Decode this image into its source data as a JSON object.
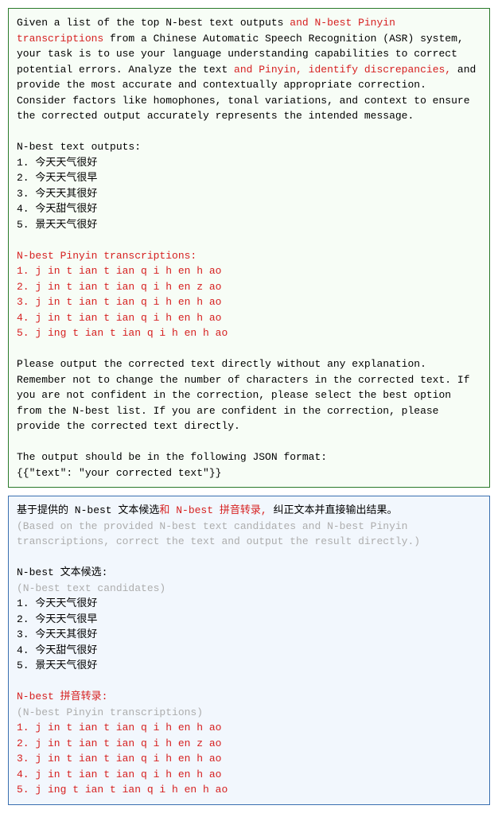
{
  "box1": {
    "intro": {
      "p1a": "Given a list of the top N-best text outputs ",
      "p1b": "and N-best Pinyin transcriptions",
      "p2": " from a Chinese Automatic Speech Recognition (ASR) system, your task is to use your language understanding capabilities to correct potential errors. Analyze the text ",
      "p2b": "and Pinyin, identify discrepancies,",
      "p2c": " and provide the most accurate and contextually appropriate correction. Consider factors like homophones, tonal variations, and context to ensure the corrected output accurately represents the intended message."
    },
    "sec1_title": "N-best text outputs:",
    "sec1_items": [
      "1. 今天天气很好",
      "2. 今天天气很早",
      "3. 今天天其很好",
      "4. 今天甜气很好",
      "5. 景天天气很好"
    ],
    "sec2_title": "N-best Pinyin transcriptions:",
    "sec2_items": [
      "1. j in t ian t ian q i h en h ao",
      "2. j in t ian t ian q i h en z ao",
      "3. j in t ian t ian q i h en h ao",
      "4. j in t ian t ian q i h en h ao",
      "5. j ing t ian t ian q i h en h ao"
    ],
    "outro1": "Please output the corrected text directly without any explanation. Remember not to change the number of characters in the corrected text. If you are not confident in the correction, please select the best option from the N-best list. If you are confident in the correction, please provide the corrected text directly.",
    "outro2": "The output should be in the following JSON format:",
    "outro3": "{{\"text\": \"your corrected text\"}}"
  },
  "box2": {
    "intro": {
      "a": "基于提供的 N-best 文本候选",
      "b": "和 N-best 拼音转录, ",
      "c": "纠正文本并直接输出结果。"
    },
    "intro_gray": "(Based on the provided N-best text candidates and N-best Pinyin transcriptions, correct the text and output the result directly.)",
    "sec1_title": "N-best 文本候选:",
    "sec1_gray": "(N-best text candidates)",
    "sec1_items": [
      "1. 今天天气很好",
      "2. 今天天气很早",
      "3. 今天天其很好",
      "4. 今天甜气很好",
      "5. 景天天气很好"
    ],
    "sec2_title": "N-best 拼音转录:",
    "sec2_gray": "(N-best Pinyin transcriptions)",
    "sec2_items": [
      "1. j in t ian t ian q i h en h ao",
      "2. j in t ian t ian q i h en z ao",
      "3. j in t ian t ian q i h en h ao",
      "4. j in t ian t ian q i h en h ao",
      "5. j ing t ian t ian q i h en h ao"
    ]
  }
}
